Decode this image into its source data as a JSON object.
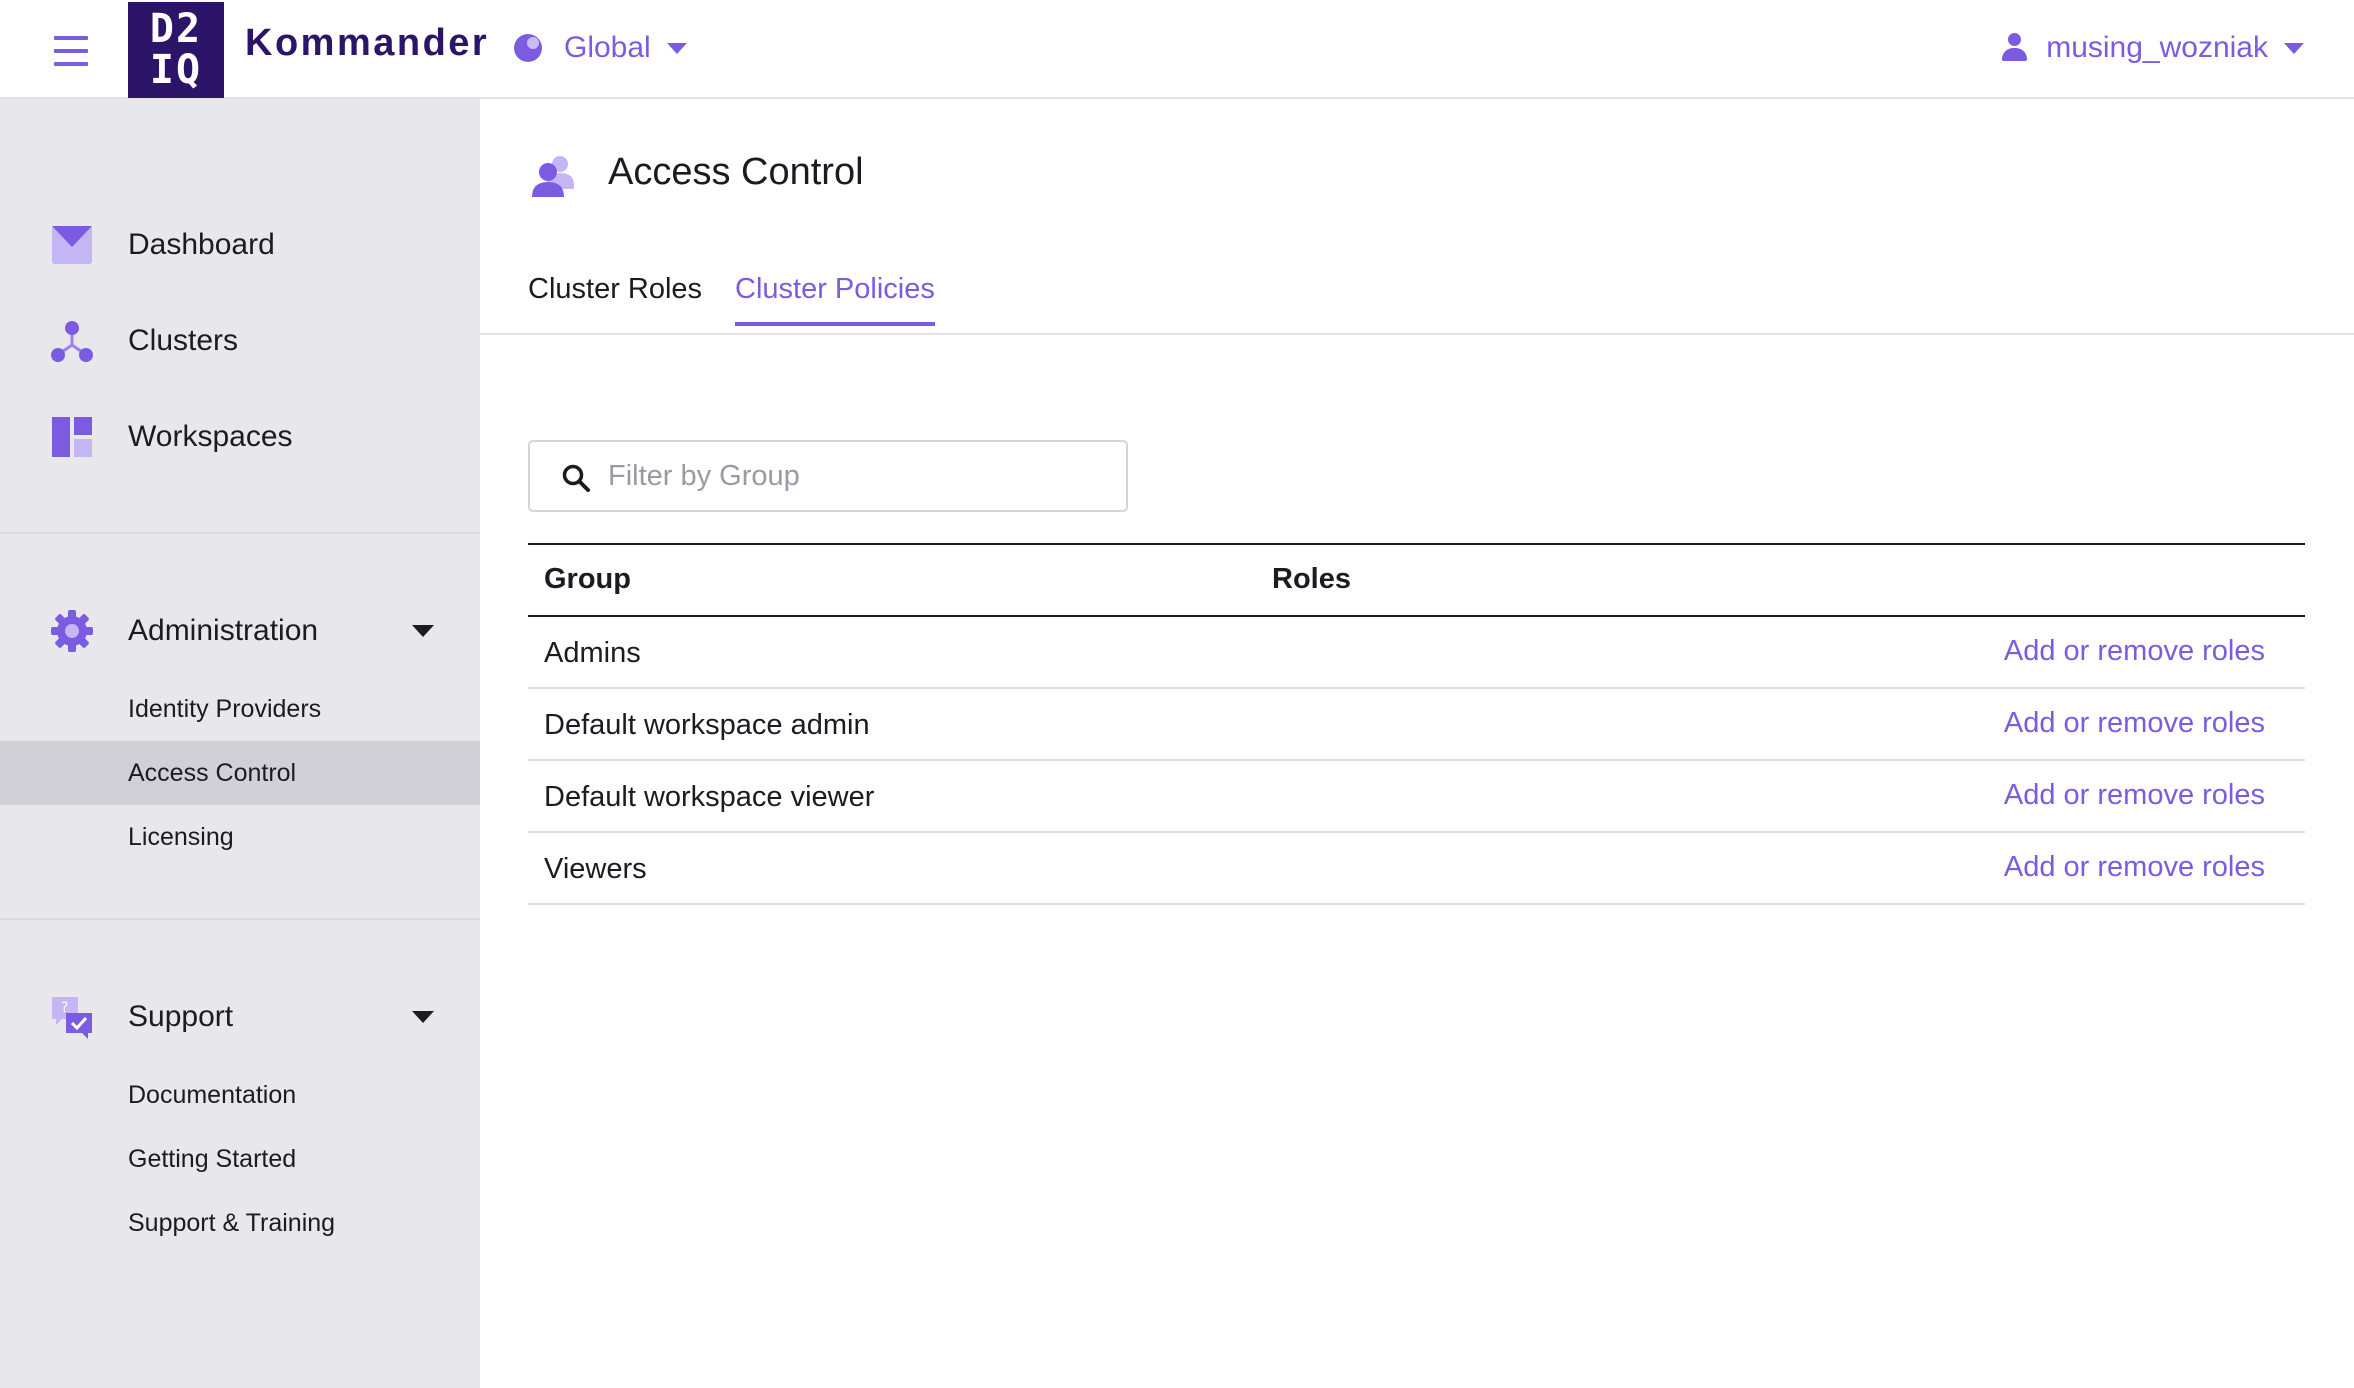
{
  "header": {
    "logo_line1": "D2",
    "logo_line2": "IQ",
    "app_name": "Kommander",
    "scope": "Global",
    "user": "musing_wozniak"
  },
  "sidebar": {
    "primary": [
      {
        "label": "Dashboard",
        "icon": "dashboard-icon"
      },
      {
        "label": "Clusters",
        "icon": "clusters-icon"
      },
      {
        "label": "Workspaces",
        "icon": "workspaces-icon"
      }
    ],
    "administration": {
      "label": "Administration",
      "icon": "gear-icon",
      "items": [
        {
          "label": "Identity Providers",
          "active": false
        },
        {
          "label": "Access Control",
          "active": true
        },
        {
          "label": "Licensing",
          "active": false
        }
      ]
    },
    "support": {
      "label": "Support",
      "icon": "support-icon",
      "items": [
        {
          "label": "Documentation"
        },
        {
          "label": "Getting Started"
        },
        {
          "label": "Support & Training"
        }
      ]
    }
  },
  "main": {
    "title": "Access Control",
    "tabs": [
      {
        "label": "Cluster Roles",
        "active": false
      },
      {
        "label": "Cluster Policies",
        "active": true
      }
    ],
    "search": {
      "placeholder": "Filter by Group",
      "value": ""
    },
    "table": {
      "columns": [
        "Group",
        "Roles"
      ],
      "rows": [
        {
          "group": "Admins",
          "action": "Add or remove roles"
        },
        {
          "group": "Default workspace admin",
          "action": "Add or remove roles"
        },
        {
          "group": "Default workspace viewer",
          "action": "Add or remove roles"
        },
        {
          "group": "Viewers",
          "action": "Add or remove roles"
        }
      ]
    }
  },
  "colors": {
    "accent": "#7b5ce0",
    "brand": "#2c1469",
    "sidebar_bg": "#e8e8ec",
    "sidebar_active": "#d0d0d6"
  }
}
